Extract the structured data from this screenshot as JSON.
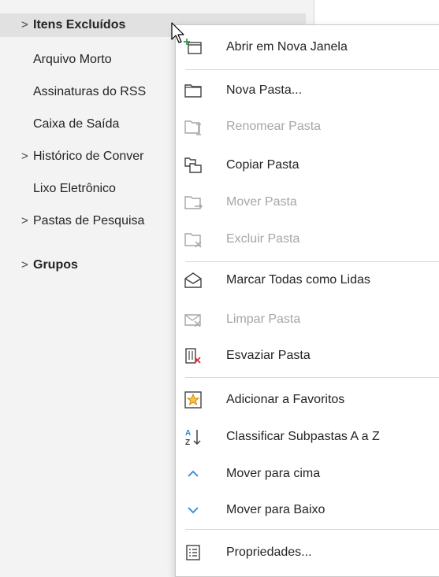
{
  "folders": {
    "itens_excluidos": "Itens Excluídos",
    "arquivo_morto": "Arquivo Morto",
    "assinaturas_rss": "Assinaturas do RSS",
    "caixa_saida": "Caixa de Saída",
    "historico": "Histórico de Conver",
    "lixo": "Lixo Eletrônico",
    "pastas_pesquisa": "Pastas de Pesquisa",
    "grupos": "Grupos",
    "chevron": ">"
  },
  "menu": {
    "abrir": "Abrir em Nova Janela",
    "nova_pasta": "Nova Pasta...",
    "renomear": "Renomear Pasta",
    "copiar": "Copiar Pasta",
    "mover": "Mover Pasta",
    "excluir": "Excluir Pasta",
    "marcar": "Marcar Todas como Lidas",
    "limpar": "Limpar Pasta",
    "esvaziar": "Esvaziar Pasta",
    "favoritos": "Adicionar a Favoritos",
    "classificar": "Classificar Subpastas A a  Z",
    "mover_cima": "Mover para cima",
    "mover_baixo": "Mover para Baixo",
    "propriedades": "Propriedades..."
  },
  "colors": {
    "accent_blue": "#2b88d8",
    "accent_green": "#1e9b3d",
    "danger_red": "#d13438",
    "favorite_orange": "#e8a317",
    "disabled_gray": "#a6a6a6"
  }
}
